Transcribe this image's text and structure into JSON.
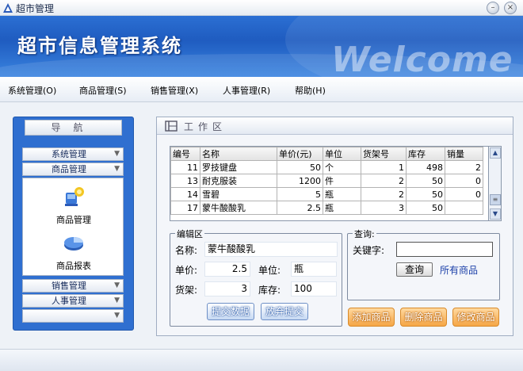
{
  "window": {
    "title": "超市管理",
    "minimize_icon": "minimize-icon",
    "close_icon": "close-icon"
  },
  "banner": {
    "title": "超市信息管理系统",
    "welcome": "Welcome"
  },
  "menu": [
    {
      "label": "系统管理(O)"
    },
    {
      "label": "商品管理(S)"
    },
    {
      "label": "销售管理(X)"
    },
    {
      "label": "人事管理(R)"
    },
    {
      "label": "帮助(H)"
    }
  ],
  "nav": {
    "header": "导航",
    "categories": [
      {
        "label": "系统管理"
      },
      {
        "label": "商品管理"
      },
      {
        "label": "销售管理"
      },
      {
        "label": "人事管理"
      }
    ],
    "tools": [
      {
        "label": "商品管理",
        "icon": "goods-management-icon"
      },
      {
        "label": "商品报表",
        "icon": "pie-chart-icon"
      }
    ]
  },
  "work": {
    "header": "工作区",
    "table": {
      "columns": [
        "编号",
        "名称",
        "单价(元)",
        "单位",
        "货架号",
        "库存",
        "销量"
      ],
      "rows": [
        [
          "11",
          "罗技键盘",
          "50",
          "个",
          "1",
          "498",
          "2"
        ],
        [
          "13",
          "耐克服装",
          "1200",
          "件",
          "2",
          "50",
          "0"
        ],
        [
          "14",
          "雪碧",
          "5",
          "瓶",
          "2",
          "50",
          "0"
        ],
        [
          "17",
          "蒙牛酸酸乳",
          "2.5",
          "瓶",
          "3",
          "50",
          ""
        ]
      ]
    },
    "edit": {
      "legend": "编辑区",
      "name_label": "名称:",
      "name_value": "蒙牛酸酸乳",
      "price_label": "单价:",
      "price_value": "2.5",
      "unit_label": "单位:",
      "unit_value": "瓶",
      "shelf_label": "货架:",
      "shelf_value": "3",
      "stock_label": "库存:",
      "stock_value": "100",
      "submit_label": "提交数据",
      "cancel_label": "放弃提交"
    },
    "query": {
      "legend": "查询:",
      "keyword_label": "关键字:",
      "keyword_value": "",
      "search_label": "查询",
      "all_label": "所有商品"
    },
    "actions": {
      "add": "添加商品",
      "delete": "删除商品",
      "modify": "修改商品"
    }
  }
}
